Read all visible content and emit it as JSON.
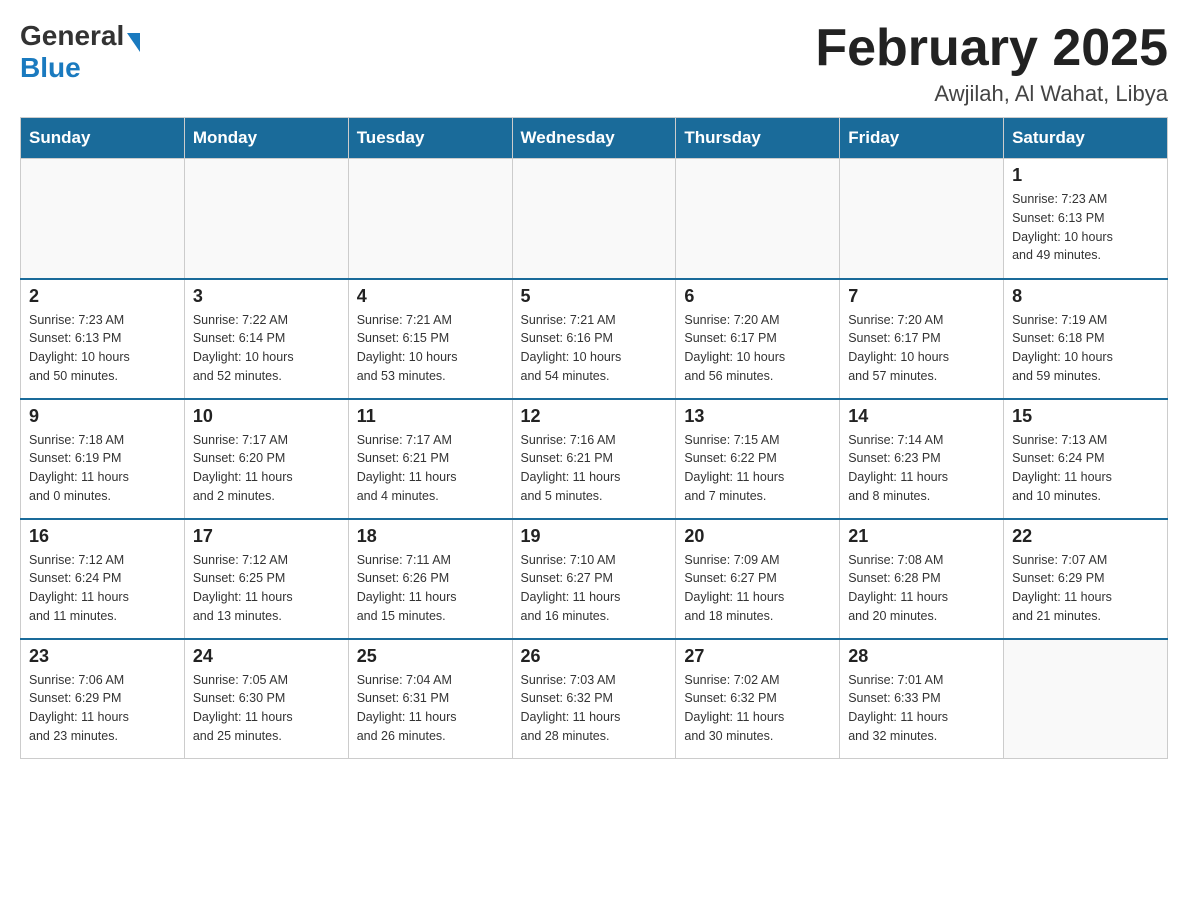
{
  "header": {
    "logo_general": "General",
    "logo_blue": "Blue",
    "title": "February 2025",
    "subtitle": "Awjilah, Al Wahat, Libya"
  },
  "days_of_week": [
    "Sunday",
    "Monday",
    "Tuesday",
    "Wednesday",
    "Thursday",
    "Friday",
    "Saturday"
  ],
  "weeks": [
    [
      {
        "day": "",
        "info": ""
      },
      {
        "day": "",
        "info": ""
      },
      {
        "day": "",
        "info": ""
      },
      {
        "day": "",
        "info": ""
      },
      {
        "day": "",
        "info": ""
      },
      {
        "day": "",
        "info": ""
      },
      {
        "day": "1",
        "info": "Sunrise: 7:23 AM\nSunset: 6:13 PM\nDaylight: 10 hours\nand 49 minutes."
      }
    ],
    [
      {
        "day": "2",
        "info": "Sunrise: 7:23 AM\nSunset: 6:13 PM\nDaylight: 10 hours\nand 50 minutes."
      },
      {
        "day": "3",
        "info": "Sunrise: 7:22 AM\nSunset: 6:14 PM\nDaylight: 10 hours\nand 52 minutes."
      },
      {
        "day": "4",
        "info": "Sunrise: 7:21 AM\nSunset: 6:15 PM\nDaylight: 10 hours\nand 53 minutes."
      },
      {
        "day": "5",
        "info": "Sunrise: 7:21 AM\nSunset: 6:16 PM\nDaylight: 10 hours\nand 54 minutes."
      },
      {
        "day": "6",
        "info": "Sunrise: 7:20 AM\nSunset: 6:17 PM\nDaylight: 10 hours\nand 56 minutes."
      },
      {
        "day": "7",
        "info": "Sunrise: 7:20 AM\nSunset: 6:17 PM\nDaylight: 10 hours\nand 57 minutes."
      },
      {
        "day": "8",
        "info": "Sunrise: 7:19 AM\nSunset: 6:18 PM\nDaylight: 10 hours\nand 59 minutes."
      }
    ],
    [
      {
        "day": "9",
        "info": "Sunrise: 7:18 AM\nSunset: 6:19 PM\nDaylight: 11 hours\nand 0 minutes."
      },
      {
        "day": "10",
        "info": "Sunrise: 7:17 AM\nSunset: 6:20 PM\nDaylight: 11 hours\nand 2 minutes."
      },
      {
        "day": "11",
        "info": "Sunrise: 7:17 AM\nSunset: 6:21 PM\nDaylight: 11 hours\nand 4 minutes."
      },
      {
        "day": "12",
        "info": "Sunrise: 7:16 AM\nSunset: 6:21 PM\nDaylight: 11 hours\nand 5 minutes."
      },
      {
        "day": "13",
        "info": "Sunrise: 7:15 AM\nSunset: 6:22 PM\nDaylight: 11 hours\nand 7 minutes."
      },
      {
        "day": "14",
        "info": "Sunrise: 7:14 AM\nSunset: 6:23 PM\nDaylight: 11 hours\nand 8 minutes."
      },
      {
        "day": "15",
        "info": "Sunrise: 7:13 AM\nSunset: 6:24 PM\nDaylight: 11 hours\nand 10 minutes."
      }
    ],
    [
      {
        "day": "16",
        "info": "Sunrise: 7:12 AM\nSunset: 6:24 PM\nDaylight: 11 hours\nand 11 minutes."
      },
      {
        "day": "17",
        "info": "Sunrise: 7:12 AM\nSunset: 6:25 PM\nDaylight: 11 hours\nand 13 minutes."
      },
      {
        "day": "18",
        "info": "Sunrise: 7:11 AM\nSunset: 6:26 PM\nDaylight: 11 hours\nand 15 minutes."
      },
      {
        "day": "19",
        "info": "Sunrise: 7:10 AM\nSunset: 6:27 PM\nDaylight: 11 hours\nand 16 minutes."
      },
      {
        "day": "20",
        "info": "Sunrise: 7:09 AM\nSunset: 6:27 PM\nDaylight: 11 hours\nand 18 minutes."
      },
      {
        "day": "21",
        "info": "Sunrise: 7:08 AM\nSunset: 6:28 PM\nDaylight: 11 hours\nand 20 minutes."
      },
      {
        "day": "22",
        "info": "Sunrise: 7:07 AM\nSunset: 6:29 PM\nDaylight: 11 hours\nand 21 minutes."
      }
    ],
    [
      {
        "day": "23",
        "info": "Sunrise: 7:06 AM\nSunset: 6:29 PM\nDaylight: 11 hours\nand 23 minutes."
      },
      {
        "day": "24",
        "info": "Sunrise: 7:05 AM\nSunset: 6:30 PM\nDaylight: 11 hours\nand 25 minutes."
      },
      {
        "day": "25",
        "info": "Sunrise: 7:04 AM\nSunset: 6:31 PM\nDaylight: 11 hours\nand 26 minutes."
      },
      {
        "day": "26",
        "info": "Sunrise: 7:03 AM\nSunset: 6:32 PM\nDaylight: 11 hours\nand 28 minutes."
      },
      {
        "day": "27",
        "info": "Sunrise: 7:02 AM\nSunset: 6:32 PM\nDaylight: 11 hours\nand 30 minutes."
      },
      {
        "day": "28",
        "info": "Sunrise: 7:01 AM\nSunset: 6:33 PM\nDaylight: 11 hours\nand 32 minutes."
      },
      {
        "day": "",
        "info": ""
      }
    ]
  ]
}
